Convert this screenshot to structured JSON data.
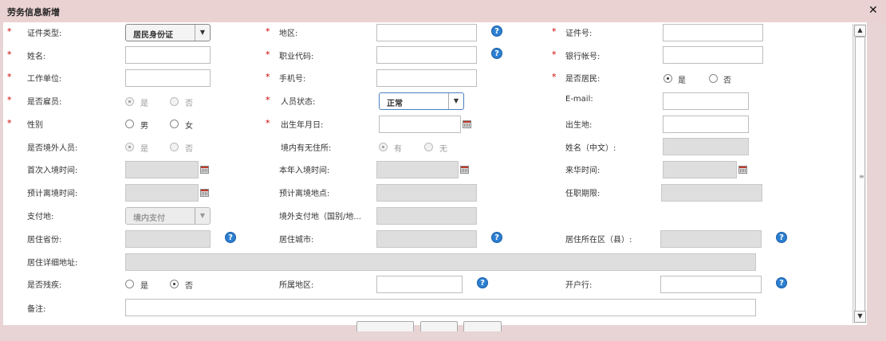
{
  "title": "劳务信息新增",
  "close_glyph": "✕",
  "fields": {
    "cert_type": {
      "label": "证件类型:",
      "value": "居民身份证"
    },
    "region": {
      "label": "地区:"
    },
    "cert_no": {
      "label": "证件号:"
    },
    "name": {
      "label": "姓名:"
    },
    "job_code": {
      "label": "职业代码:"
    },
    "bank_account": {
      "label": "银行帐号:"
    },
    "employer": {
      "label": "工作单位:"
    },
    "mobile": {
      "label": "手机号:"
    },
    "is_resident": {
      "label": "是否居民:",
      "yes": "是",
      "no": "否",
      "selected": "是"
    },
    "is_employee": {
      "label": "是否雇员:",
      "yes": "是",
      "no": "否",
      "selected": "是"
    },
    "person_status": {
      "label": "人员状态:",
      "value": "正常"
    },
    "email": {
      "label": "E-mail:"
    },
    "gender": {
      "label": "性别",
      "male": "男",
      "female": "女"
    },
    "birth_date": {
      "label": "出生年月日:"
    },
    "birth_place": {
      "label": "出生地:"
    },
    "is_foreign": {
      "label": "是否境外人员:",
      "yes": "是",
      "no": "否",
      "selected": "是"
    },
    "has_domestic_residence": {
      "label": "境内有无住所:",
      "yes": "有",
      "no": "无",
      "selected": "有"
    },
    "name_cn": {
      "label": "姓名（中文）:"
    },
    "first_entry_time": {
      "label": "首次入境时间:"
    },
    "this_year_entry_time": {
      "label": "本年入境时间:"
    },
    "arrival_time": {
      "label": "来华时间:"
    },
    "expected_departure_time": {
      "label": "预计离境时间:"
    },
    "expected_departure_place": {
      "label": "预计离境地点:"
    },
    "term_of_office": {
      "label": "任职期限:"
    },
    "payment_place": {
      "label": "支付地:",
      "value": "境内支付"
    },
    "overseas_payment_place": {
      "label": "境外支付地（国别/地..."
    },
    "residence_province": {
      "label": "居住省份:"
    },
    "residence_city": {
      "label": "居住城市:"
    },
    "residence_district": {
      "label": "居住所在区（县）:"
    },
    "residence_address": {
      "label": "居住详细地址:"
    },
    "is_disabled": {
      "label": "是否残疾:",
      "yes": "是",
      "no": "否",
      "selected": "否"
    },
    "belong_region": {
      "label": "所属地区:"
    },
    "bank_name": {
      "label": "开户行:"
    },
    "remark": {
      "label": "备注:"
    }
  },
  "required_mark": "*",
  "help_glyph": "?",
  "scroll": {
    "up": "▲",
    "down": "▼",
    "grip": "≡"
  }
}
